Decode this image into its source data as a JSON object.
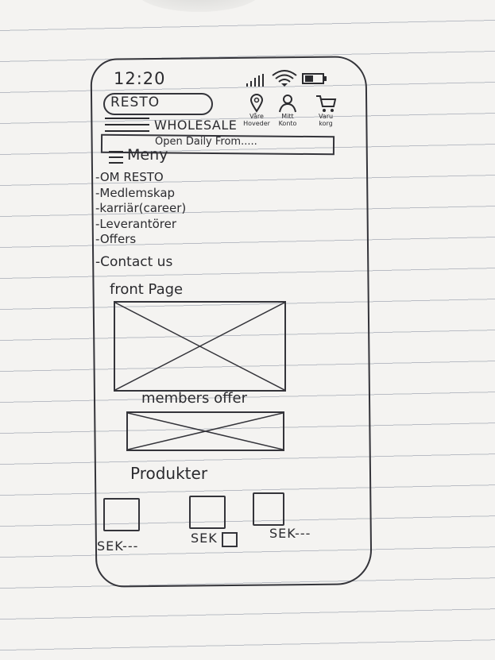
{
  "status_bar": {
    "time": "12:20"
  },
  "header": {
    "logo": "RESTO",
    "icons": [
      {
        "name": "location-icon",
        "label": "Våre Hoveder"
      },
      {
        "name": "account-icon",
        "label": "Mitt Konto"
      },
      {
        "name": "cart-icon",
        "label": "Varu korg"
      }
    ],
    "brand": "WHOLESALE",
    "opening_hours": "Open Daily From....."
  },
  "menu": {
    "title": "Meny",
    "items": [
      "-OM RESTO",
      "-Medlemskap",
      "-karriär(career)",
      "-Leverantörer",
      "-Offers",
      "-Contact us"
    ]
  },
  "sections": {
    "front_page": "front Page",
    "members_offer": "members offer",
    "products": "Produkter"
  },
  "products": [
    {
      "price": "SEK---"
    },
    {
      "price": "SEK"
    },
    {
      "price": "SEK---"
    }
  ]
}
